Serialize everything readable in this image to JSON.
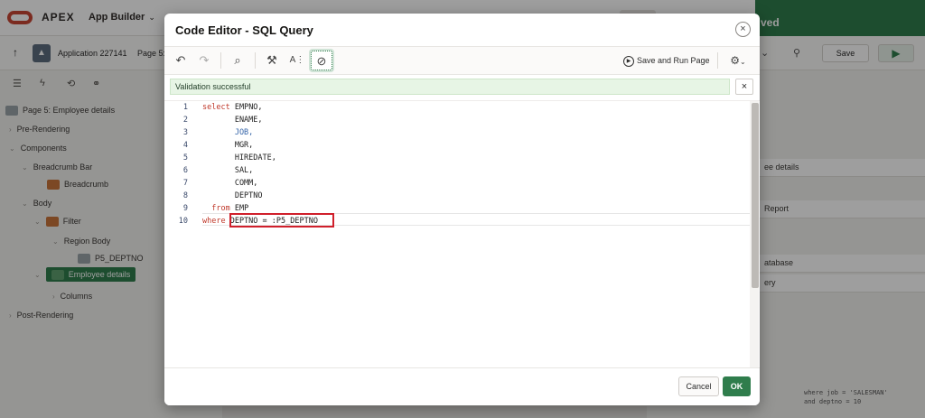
{
  "app": {
    "logo_text": "APEX",
    "app_builder_label": "App Builder",
    "toast_text": "ved"
  },
  "subbar": {
    "application_label": "Application 227141",
    "page_label": "Page 5:",
    "save_label": "Save"
  },
  "tree": {
    "root": "Page 5: Employee details",
    "nodes": [
      "Pre-Rendering",
      "Components",
      "Breadcrumb Bar",
      "Breadcrumb",
      "Body",
      "Filter",
      "Region Body",
      "P5_DEPTNO",
      "Employee details",
      "Columns",
      "Post-Rendering"
    ]
  },
  "right_pane": {
    "title_fragment": "ee details",
    "type_fragment": "Report",
    "source_fragment": "atabase",
    "query_fragment": "ery",
    "code_line1": "where job = 'SALESMAN'",
    "code_line2": "and deptno = 10"
  },
  "dialog": {
    "title": "Code Editor - SQL Query",
    "close_glyph": "×",
    "toolbar": {
      "undo_icon": "undo-icon",
      "redo_icon": "redo-icon",
      "search_icon": "search-icon",
      "hammer_icon": "hammer-icon",
      "autocomplete_label": "A⋮",
      "validate_icon": "check-circle-icon",
      "save_and_run_label": "Save and Run Page",
      "settings_icon": "gear-icon"
    },
    "validation_message": "Validation successful",
    "validation_close_glyph": "×",
    "editor": {
      "line_numbers": [
        "1",
        "2",
        "3",
        "4",
        "5",
        "6",
        "7",
        "8",
        "9",
        "10"
      ],
      "lines": [
        {
          "kw": "select",
          "text": " EMPNO,"
        },
        {
          "kw": "",
          "text": "       ENAME,"
        },
        {
          "kw": "",
          "text": "       JOB,"
        },
        {
          "kw": "",
          "text": "       MGR,"
        },
        {
          "kw": "",
          "text": "       HIREDATE,"
        },
        {
          "kw": "",
          "text": "       SAL,"
        },
        {
          "kw": "",
          "text": "       COMM,"
        },
        {
          "kw": "",
          "text": "       DEPTNO"
        },
        {
          "kw": "  from",
          "text": " EMP"
        },
        {
          "kw": "where",
          "text": " DEPTNO = :P5_DEPTNO"
        }
      ]
    },
    "footer": {
      "cancel_label": "Cancel",
      "ok_label": "OK"
    }
  },
  "colors": {
    "brand_red": "#c74634",
    "primary_green": "#2f7d4c",
    "keyword_red": "#c0392b",
    "column_blue": "#3464a8",
    "highlight_red": "#d01f2b"
  }
}
